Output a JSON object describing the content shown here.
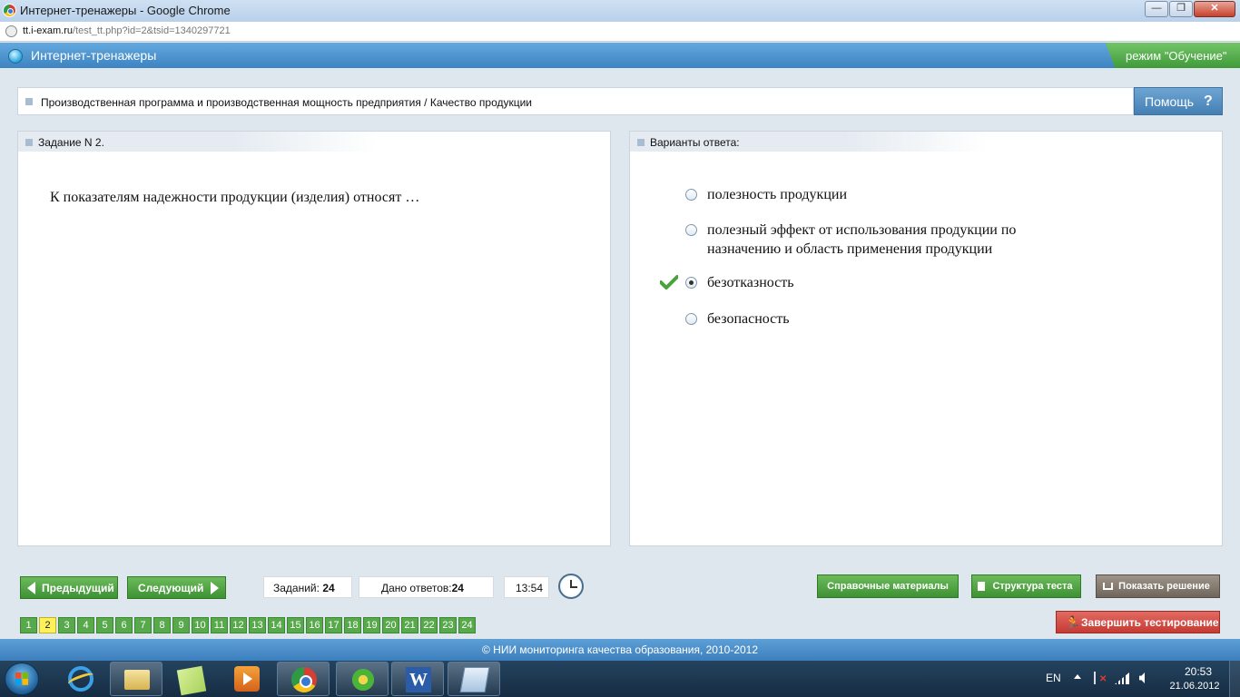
{
  "window": {
    "title": "Интернет-тренажеры - Google Chrome",
    "minimize": "—",
    "maximize": "❐",
    "close": "✕"
  },
  "address": {
    "domain": "tt.i-exam.ru",
    "path": "/test_tt.php?id=2&tsid=1340297721"
  },
  "app": {
    "title": "Интернет-тренажеры",
    "mode": "режим \"Обучение\""
  },
  "breadcrumb": "Производственная программа и производственная мощность предприятия / Качество продукции",
  "help_label": "Помощь",
  "task": {
    "header": "Задание N 2.",
    "question": "К показателям надежности продукции (изделия) относят …"
  },
  "answers": {
    "header": "Варианты ответа:",
    "options": [
      {
        "text": "полезность продукции",
        "selected": false,
        "correct": false
      },
      {
        "text": "полезный эффект от использования продукции по назначению и область применения продукции",
        "selected": false,
        "correct": false
      },
      {
        "text": "безотказность",
        "selected": true,
        "correct": true
      },
      {
        "text": "безопасность",
        "selected": false,
        "correct": false
      }
    ]
  },
  "controls": {
    "prev_label": "Предыдущий",
    "next_label": "Следующий",
    "tasks_label": "Заданий:",
    "tasks_value": "24",
    "answers_label": "Дано ответов:",
    "answers_value": "24",
    "timer": "13:54",
    "reference_label": "Справочные материалы",
    "structure_label": "Структура теста",
    "solution_label": "Показать решение",
    "finish_label": "Завершить тестирование"
  },
  "pages": [
    "1",
    "2",
    "3",
    "4",
    "5",
    "6",
    "7",
    "8",
    "9",
    "10",
    "11",
    "12",
    "13",
    "14",
    "15",
    "16",
    "17",
    "18",
    "19",
    "20",
    "21",
    "22",
    "23",
    "24"
  ],
  "current_page": "2",
  "footer": "© НИИ мониторинга качества образования, 2010-2012",
  "tray": {
    "language": "EN",
    "time": "20:53",
    "date": "21.06.2012"
  },
  "colors": {
    "header_blue": "#3d83c2",
    "green_button": "#3d9134",
    "red_button": "#c53b33",
    "current_page_yellow": "#fff15a"
  },
  "taskbar_icons": [
    "internet-explorer-icon",
    "explorer-icon",
    "sticky-notes-icon",
    "media-player-icon",
    "chrome-icon",
    "icq-icon",
    "word-icon",
    "notepad-icon"
  ]
}
